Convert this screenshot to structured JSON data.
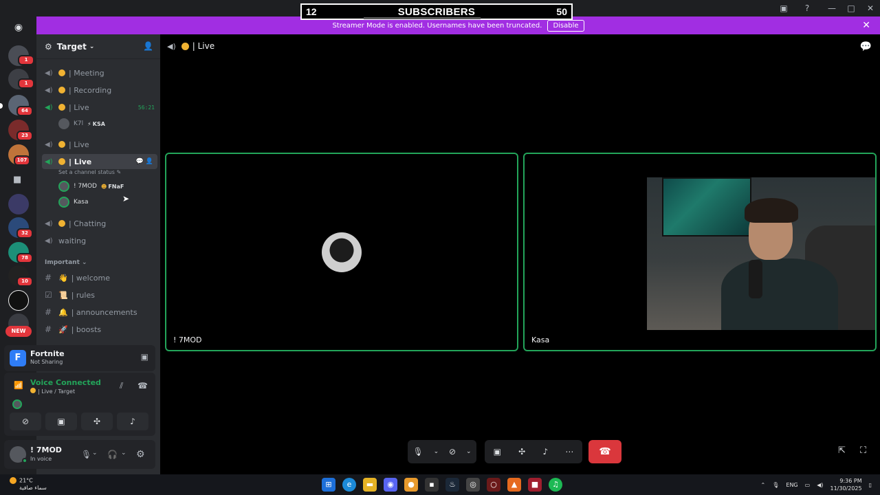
{
  "overlay": {
    "sub_count": "12",
    "sub_title": "SUBSCRIBERS",
    "sub_goal": "50"
  },
  "streamer_banner": {
    "text": "Streamer Mode is enabled. Usernames have been truncated.",
    "disable_label": "Disable"
  },
  "servers": {
    "badges": [
      "1",
      "1",
      "64",
      "23",
      "107",
      "32",
      "78",
      "10"
    ],
    "new_label": "NEW"
  },
  "sidebar": {
    "server_name": "Target",
    "channels": [
      {
        "name": "| Meeting"
      },
      {
        "name": "| Recording"
      },
      {
        "name": "| Live",
        "timer": "56:21"
      },
      {
        "name": "| Live"
      },
      {
        "name": "| Live"
      },
      {
        "name": "| Chatting"
      },
      {
        "name": "waiting"
      }
    ],
    "live1_users": [
      {
        "name": "K7l",
        "activity": "KSA"
      }
    ],
    "channel_status_hint": "Set a channel status",
    "live3_users": [
      {
        "name": "! 7MOD",
        "activity": "FNaF"
      },
      {
        "name": "Kasa"
      }
    ],
    "category": "Important",
    "text_channels": [
      {
        "emoji": "👋",
        "name": "| welcome"
      },
      {
        "emoji": "📜",
        "name": "| rules"
      },
      {
        "emoji": "🔔",
        "name": "| announcements"
      },
      {
        "emoji": "🚀",
        "name": "| boosts"
      }
    ]
  },
  "activity_panel": {
    "game": "Fortnite",
    "status": "Not Sharing"
  },
  "voice_panel": {
    "title": "Voice Connected",
    "channel": "| Live / Target"
  },
  "user_panel": {
    "name": "! 7MOD",
    "status": "In voice"
  },
  "main": {
    "channel_title": "| Live",
    "tiles": [
      {
        "label": "! 7MOD"
      },
      {
        "label": "Kasa"
      }
    ]
  },
  "taskbar": {
    "temp": "21°C",
    "weather": "سماء صافية",
    "lang": "ENG",
    "time": "9:36 PM",
    "date": "11/30/2025"
  },
  "colors": {
    "accent_green": "#23a55a",
    "streamer_purple": "#a12ee2",
    "danger_red": "#da373c",
    "status_yellow": "#f0b232"
  }
}
